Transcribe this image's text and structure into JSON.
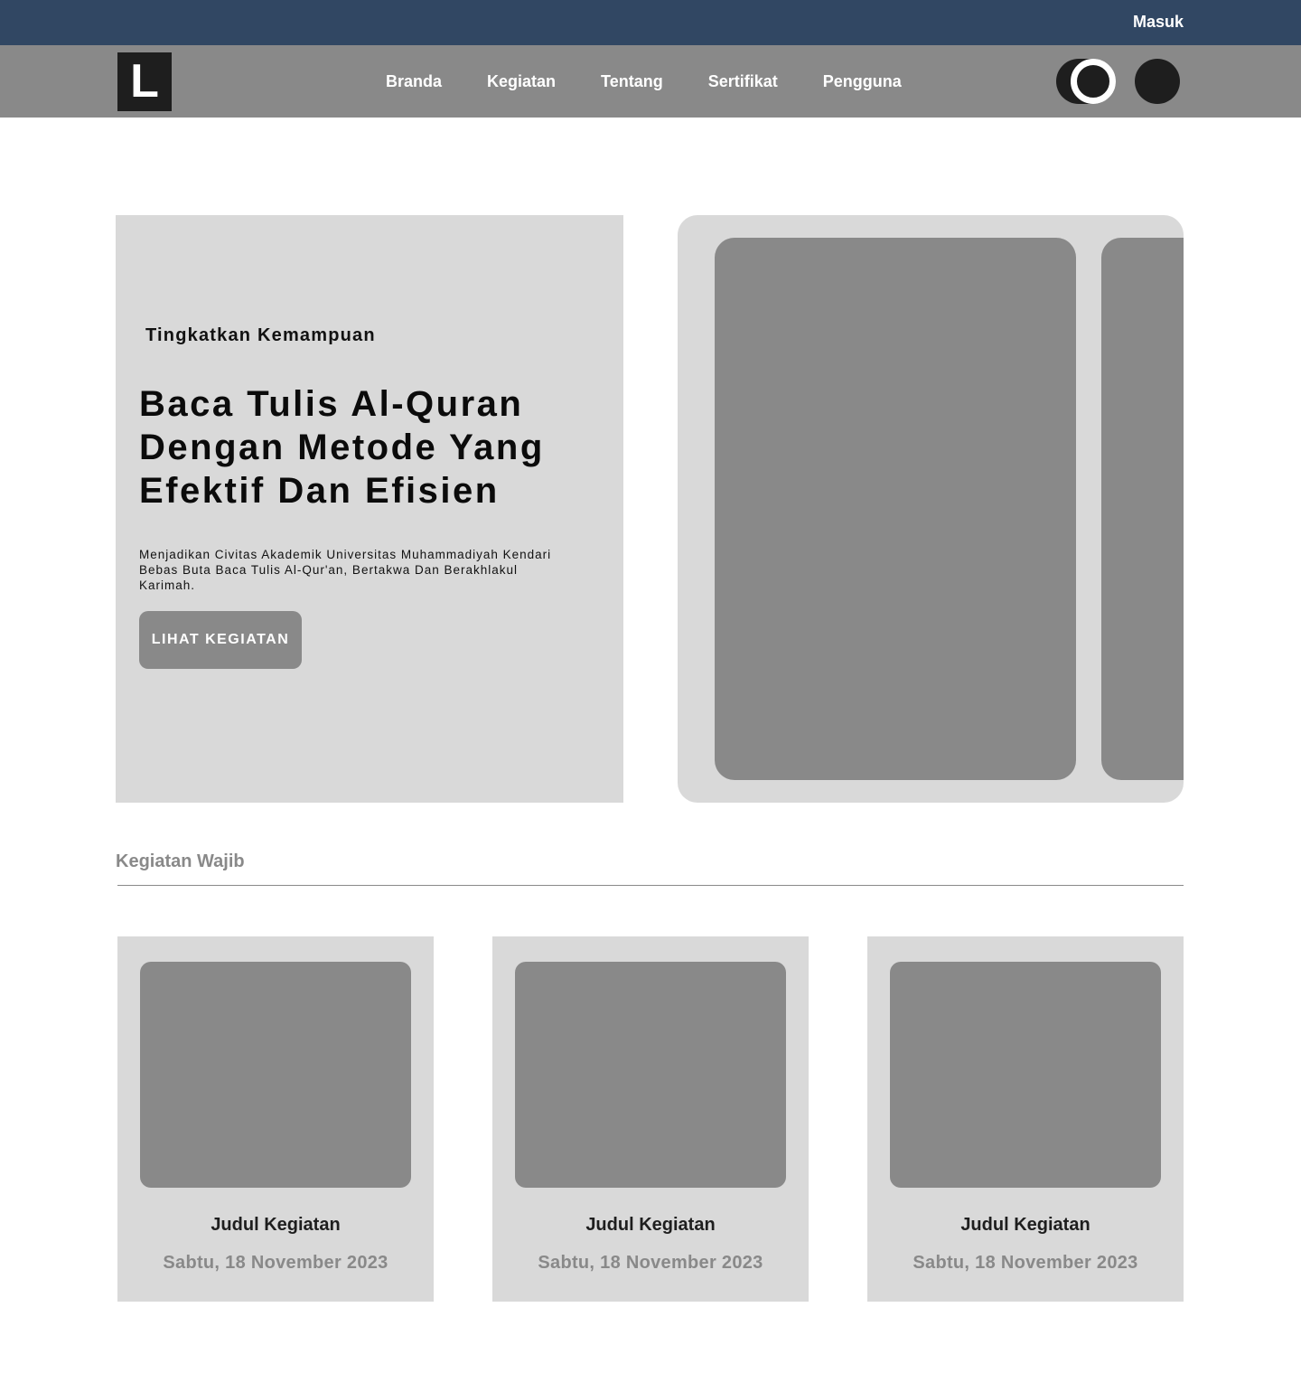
{
  "topbar": {
    "login_label": "Masuk",
    "color": "#314763"
  },
  "navbar": {
    "logo_letter": "L",
    "links": [
      "Branda",
      "Kegiatan",
      "Tentang",
      "Sertifikat",
      "Pengguna"
    ],
    "color": "#898989"
  },
  "hero": {
    "eyebrow": "Tingkatkan Kemampuan",
    "title": "Baca Tulis Al-Quran Dengan Metode Yang Efektif Dan Efisien",
    "subtitle": "Menjadikan Civitas Akademik Universitas Muhammadiyah Kendari Bebas Buta Baca Tulis Al-Qur'an, Bertakwa Dan Berakhlakul Karimah.",
    "button_label": "LIHAT KEGIATAN"
  },
  "section": {
    "title": "Kegiatan Wajib"
  },
  "cards": [
    {
      "title": "Judul Kegiatan",
      "date": "Sabtu, 18 November 2023"
    },
    {
      "title": "Judul Kegiatan",
      "date": "Sabtu, 18 November 2023"
    },
    {
      "title": "Judul Kegiatan",
      "date": "Sabtu, 18 November 2023"
    }
  ]
}
